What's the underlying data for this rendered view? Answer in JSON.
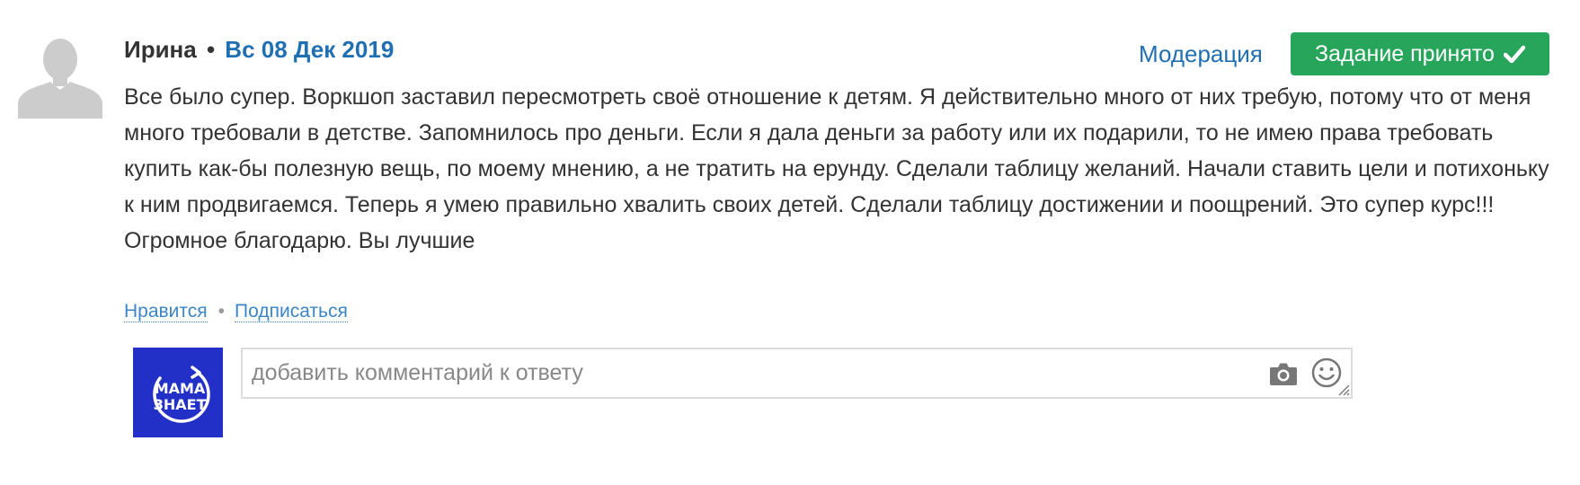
{
  "review": {
    "author": "Ирина",
    "separator": "•",
    "date": "Вс 08 Дек 2019",
    "moderation_label": "Модерация",
    "status_button_label": "Задание принято",
    "status_button_color": "#27a55a",
    "text": "Все было супер. Воркшоп заставил пересмотреть своё отношение к детям. Я действительно много от них требую, потому что от меня много требовали в детстве. Запомнилось про деньги. Если я дала деньги за работу или их подарили, то не имею права требовать купить как-бы полезную вещь, по моему мнению, а не тратить на ерунду. Сделали таблицу желаний. Начали ставить цели и потихоньку к ним продвигаемся. Теперь я умею правильно хвалить своих детей. Сделали таблицу достижении и поощрений. Это супер курс!!! Огромное благодарю. Вы лучшие"
  },
  "actions": {
    "like_label": "Нравится",
    "dot": "•",
    "subscribe_label": "Подписаться"
  },
  "comment": {
    "placeholder": "добавить комментарий к ответу",
    "avatar_logo_line1": "МАМА",
    "avatar_logo_line2": "ЗНАЕТ",
    "avatar_bg_color": "#2330c8",
    "icons": [
      "camera-icon",
      "smile-icon"
    ]
  },
  "colors": {
    "link": "#1f6fb2",
    "text": "#333333"
  }
}
